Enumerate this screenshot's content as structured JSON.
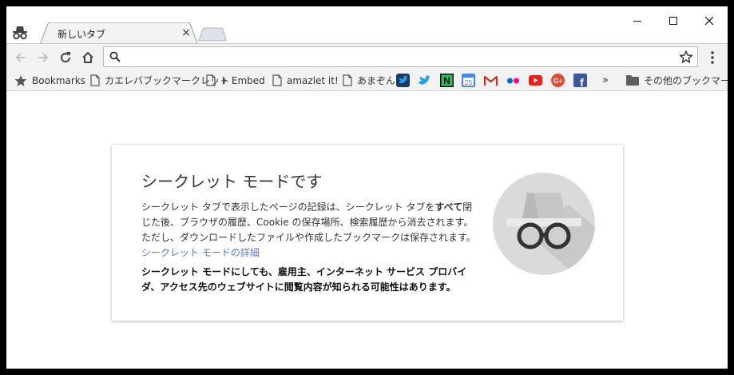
{
  "tab": {
    "title": "新しいタブ",
    "close_icon": "×"
  },
  "omnibox": {
    "value": "",
    "placeholder": ""
  },
  "bookmarks": {
    "bar_label": "Bookmarks",
    "items": [
      "カエレバブックマークレット",
      "+ Embed",
      "amazlet it!",
      "あまぞん"
    ],
    "overflow": "»",
    "other_folder": "その他のブックマーク",
    "calendar_day": "25",
    "evernote_letter": "N",
    "gmail_letter": "M",
    "gplus_letter": "G+",
    "facebook_letter": "f"
  },
  "incognito": {
    "title": "シークレット モードです",
    "p1_before": "シークレット タブで表示したページの記録は、シークレット タブを",
    "p1_bold": "すべて",
    "p1_after": "閉じた後、ブラウザの履歴、Cookie の保存場所、検索履歴から消去されます。ただし、ダウンロードしたファイルや作成したブックマークは保存されます。",
    "learn_more": "シークレット モードの詳細",
    "p2": "シークレット モードにしても、雇用主、インターネット サービス プロバイダ、アクセス先のウェブサイトに閲覧内容が知られる可能性はあります。"
  },
  "colors": {
    "link": "#5b7ac9",
    "twitter": "#1da1f2",
    "evernote": "#2dbe60",
    "gmail": "#d93025",
    "flickr_pink": "#ff0084",
    "flickr_blue": "#0063dc",
    "youtube": "#e62117",
    "gplus": "#dd4b39",
    "facebook": "#3b5998",
    "calendar": "#4a86e8"
  }
}
